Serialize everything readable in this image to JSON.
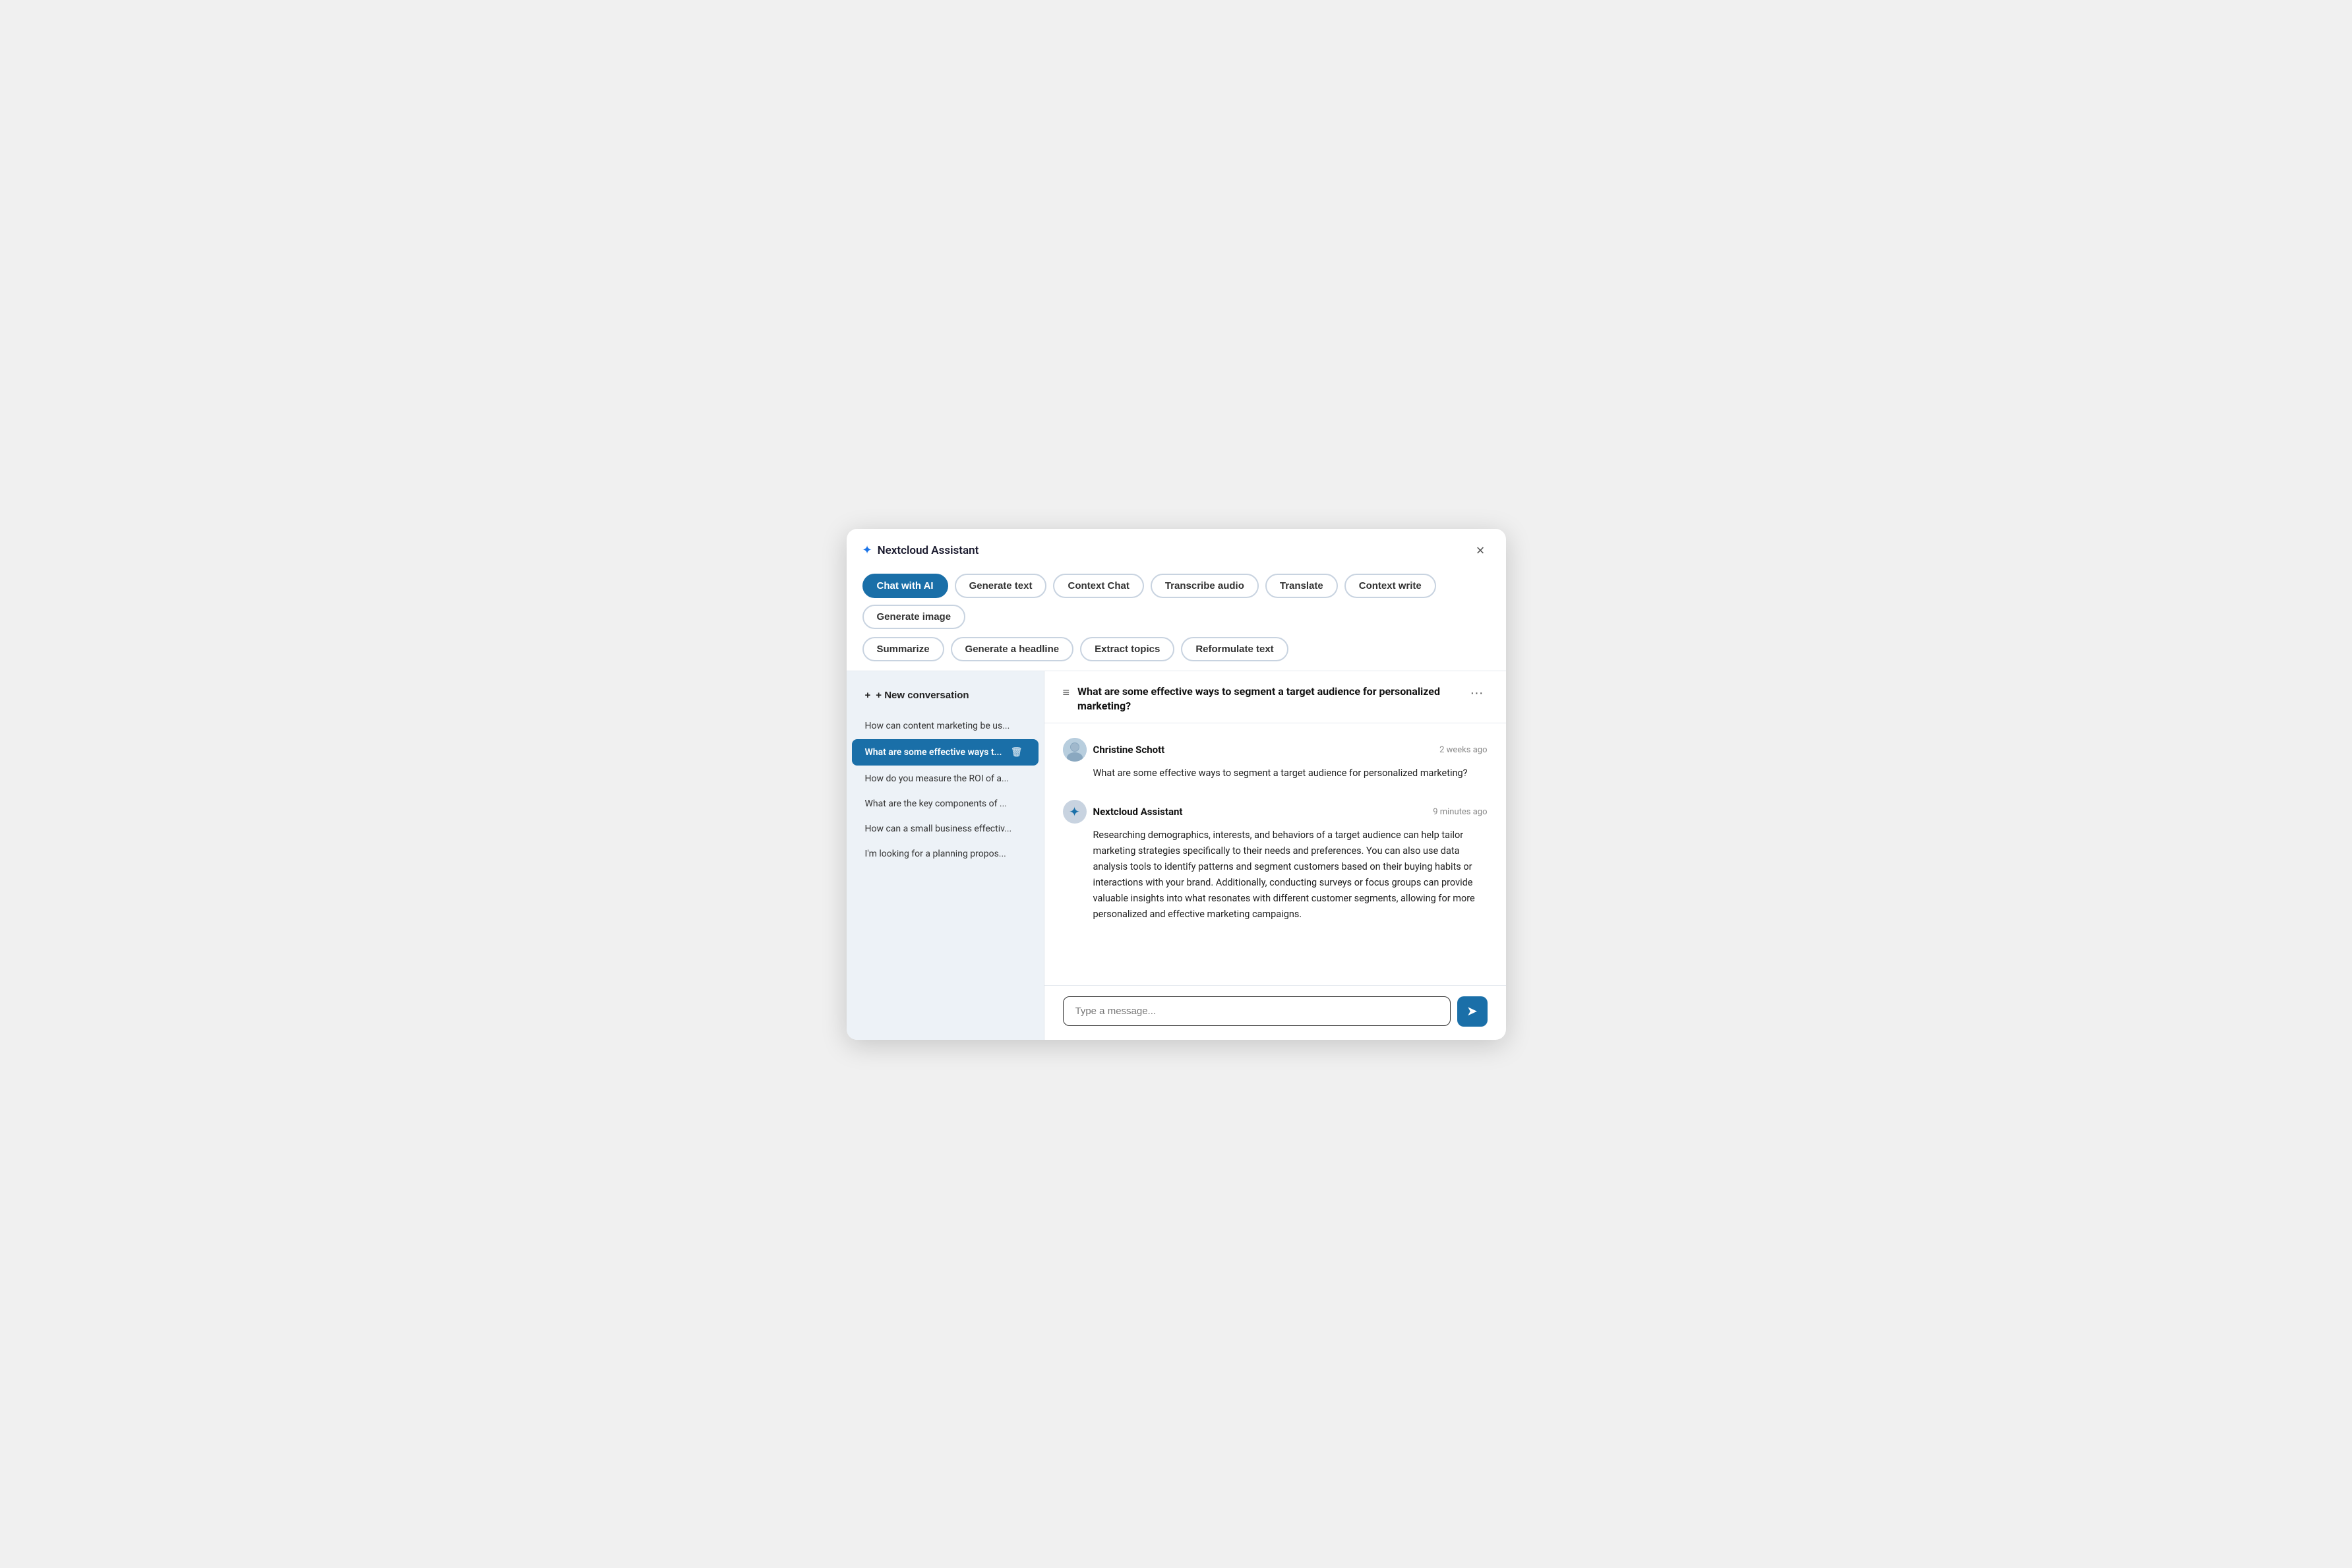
{
  "modal": {
    "title": "Nextcloud Assistant",
    "close_label": "×"
  },
  "tabs_row1": [
    {
      "id": "chat-with-ai",
      "label": "Chat with AI",
      "active": true
    },
    {
      "id": "generate-text",
      "label": "Generate text",
      "active": false
    },
    {
      "id": "context-chat",
      "label": "Context Chat",
      "active": false
    },
    {
      "id": "transcribe-audio",
      "label": "Transcribe audio",
      "active": false
    },
    {
      "id": "translate",
      "label": "Translate",
      "active": false
    },
    {
      "id": "context-write",
      "label": "Context write",
      "active": false
    },
    {
      "id": "generate-image",
      "label": "Generate image",
      "active": false
    }
  ],
  "tabs_row2": [
    {
      "id": "summarize",
      "label": "Summarize",
      "active": false
    },
    {
      "id": "generate-headline",
      "label": "Generate a headline",
      "active": false
    },
    {
      "id": "extract-topics",
      "label": "Extract topics",
      "active": false
    },
    {
      "id": "reformulate-text",
      "label": "Reformulate text",
      "active": false
    }
  ],
  "sidebar": {
    "new_conversation_label": "+ New conversation",
    "conversations": [
      {
        "id": "conv1",
        "text": "How can content marketing be us...",
        "active": false
      },
      {
        "id": "conv2",
        "text": "What are some effective ways t...",
        "active": true
      },
      {
        "id": "conv3",
        "text": "How do you measure the ROI of a...",
        "active": false
      },
      {
        "id": "conv4",
        "text": "What are the key components of ...",
        "active": false
      },
      {
        "id": "conv5",
        "text": "How can a small business effectiv...",
        "active": false
      },
      {
        "id": "conv6",
        "text": "I'm looking for a planning propos...",
        "active": false
      }
    ]
  },
  "chat": {
    "title": "What are some effective ways to segment a target audience for personalized marketing?",
    "messages": [
      {
        "id": "msg1",
        "sender": "Christine Schott",
        "time": "2 weeks ago",
        "content": "What are some effective ways to segment a target audience for personalized marketing?",
        "type": "user"
      },
      {
        "id": "msg2",
        "sender": "Nextcloud Assistant",
        "time": "9 minutes ago",
        "content": "Researching demographics, interests, and behaviors of a target audience can help tailor marketing strategies specifically to their needs and preferences. You can also use data analysis tools to identify patterns and segment customers based on their buying habits or interactions with your brand. Additionally, conducting surveys or focus groups can provide valuable insights into what resonates with different customer segments, allowing for more personalized and effective marketing campaigns.",
        "type": "assistant"
      }
    ],
    "input_placeholder": "Type a message...",
    "send_label": "➤"
  }
}
